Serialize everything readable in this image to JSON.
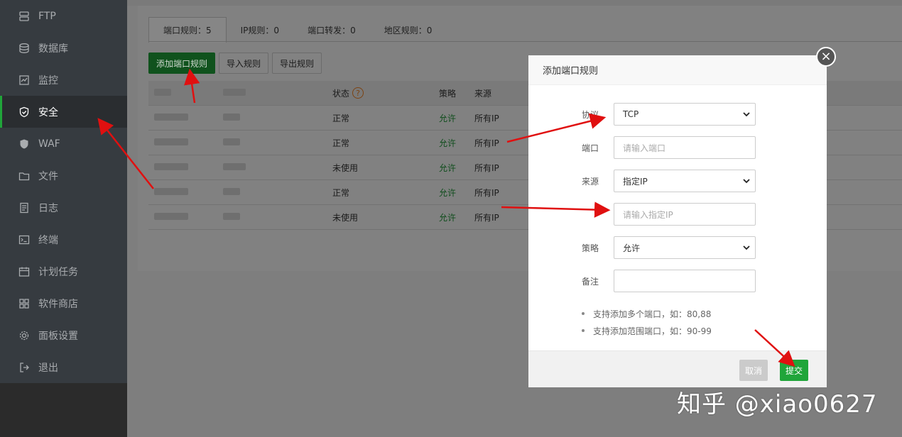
{
  "sidebar": {
    "items": [
      {
        "label": "FTP",
        "icon": "ftp-icon"
      },
      {
        "label": "数据库",
        "icon": "database-icon"
      },
      {
        "label": "监控",
        "icon": "monitor-icon"
      },
      {
        "label": "安全",
        "icon": "shield-icon",
        "active": true
      },
      {
        "label": "WAF",
        "icon": "waf-shield-icon"
      },
      {
        "label": "文件",
        "icon": "folder-icon"
      },
      {
        "label": "日志",
        "icon": "log-icon"
      },
      {
        "label": "终端",
        "icon": "terminal-icon"
      },
      {
        "label": "计划任务",
        "icon": "calendar-icon"
      },
      {
        "label": "软件商店",
        "icon": "grid-icon"
      },
      {
        "label": "面板设置",
        "icon": "gear-icon"
      },
      {
        "label": "退出",
        "icon": "logout-icon"
      }
    ]
  },
  "tabs": [
    {
      "label": "端口规则：5"
    },
    {
      "label": "IP规则：0"
    },
    {
      "label": "端口转发：0"
    },
    {
      "label": "地区规则：0"
    }
  ],
  "toolbar": {
    "add_label": "添加端口规则",
    "import_label": "导入规则",
    "export_label": "导出规则"
  },
  "table": {
    "headers": {
      "status": "状态",
      "policy": "策略",
      "source": "来源"
    },
    "rows": [
      {
        "status": "正常",
        "policy": "允许",
        "source": "所有IP"
      },
      {
        "status": "正常",
        "policy": "允许",
        "source": "所有IP"
      },
      {
        "status": "未使用",
        "policy": "允许",
        "source": "所有IP"
      },
      {
        "status": "正常",
        "policy": "允许",
        "source": "所有IP"
      },
      {
        "status": "未使用",
        "policy": "允许",
        "source": "所有IP"
      }
    ]
  },
  "modal": {
    "title": "添加端口规则",
    "fields": {
      "protocol": {
        "label": "协议",
        "value": "TCP"
      },
      "port": {
        "label": "端口",
        "placeholder": "请输入端口"
      },
      "source": {
        "label": "来源",
        "value": "指定IP"
      },
      "ip": {
        "placeholder": "请输入指定IP"
      },
      "policy": {
        "label": "策略",
        "value": "允许"
      },
      "remark": {
        "label": "备注",
        "value": ""
      }
    },
    "tips": [
      "支持添加多个端口，如：80,88",
      "支持添加范围端口，如：90-99"
    ],
    "cancel_label": "取消",
    "submit_label": "提交"
  },
  "watermark": "知乎 @xiao0627",
  "colors": {
    "accent": "#20a53a",
    "annotation_arrow": "#e01010"
  }
}
